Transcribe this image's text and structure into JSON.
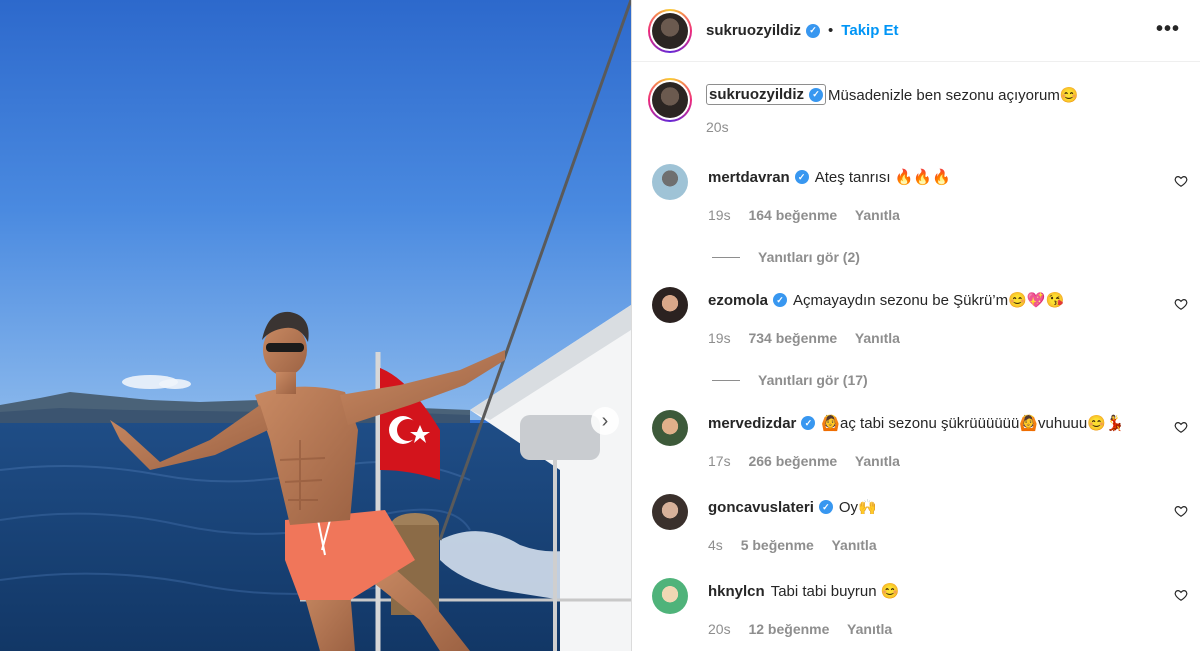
{
  "post": {
    "username": "sukruozyildiz",
    "follow_label": "Takip Et",
    "more_label": "•••",
    "verified_mark": "✓",
    "caption": "Müsadenizle ben sezonu açıyorum😊",
    "time": "20s",
    "next_arrow": "›"
  },
  "comments": [
    {
      "user": "mertdavran",
      "verified": true,
      "text": "Ateş tanrısı 🔥🔥🔥",
      "time": "19s",
      "likes": "164 beğenme",
      "reply": "Yanıtla",
      "view_replies": "Yanıtları gör (2)",
      "avatar_color": "#9fc3d6"
    },
    {
      "user": "ezomola",
      "verified": true,
      "text": "Açmayaydın sezonu be Şükrü’m😊💖😘",
      "time": "19s",
      "likes": "734 beğenme",
      "reply": "Yanıtla",
      "view_replies": "Yanıtları gör (17)",
      "avatar_color": "#2b2220"
    },
    {
      "user": "mervedizdar",
      "verified": true,
      "text": "🙆aç tabi sezonu şükrüüüüüü🙆vuhuuu😊💃",
      "time": "17s",
      "likes": "266 beğenme",
      "reply": "Yanıtla",
      "view_replies": "",
      "avatar_color": "#3d5a3a"
    },
    {
      "user": "goncavuslateri",
      "verified": true,
      "text": "Oy🙌",
      "time": "4s",
      "likes": "5 beğenme",
      "reply": "Yanıtla",
      "view_replies": "",
      "avatar_color": "#3a302c"
    },
    {
      "user": "hknylcn",
      "verified": false,
      "text": "Tabi tabi buyrun 😊",
      "time": "20s",
      "likes": "12 beğenme",
      "reply": "Yanıtla",
      "view_replies": "",
      "avatar_color": "#4fb37a"
    }
  ],
  "colors": {
    "accent": "#0095f6",
    "verified": "#3897f0",
    "muted": "#8e8e8e"
  }
}
